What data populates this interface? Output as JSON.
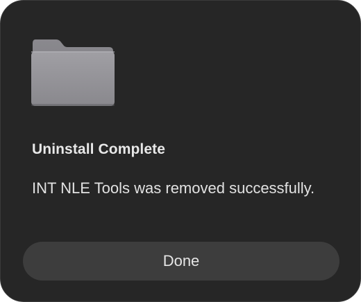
{
  "dialog": {
    "icon": "folder-icon",
    "title": "Uninstall Complete",
    "message": "INT NLE Tools was removed successfully.",
    "done_label": "Done"
  },
  "colors": {
    "background": "#262626",
    "button": "#3d3d3d",
    "text": "#e6e6e6",
    "folder": "#8e8d92"
  }
}
